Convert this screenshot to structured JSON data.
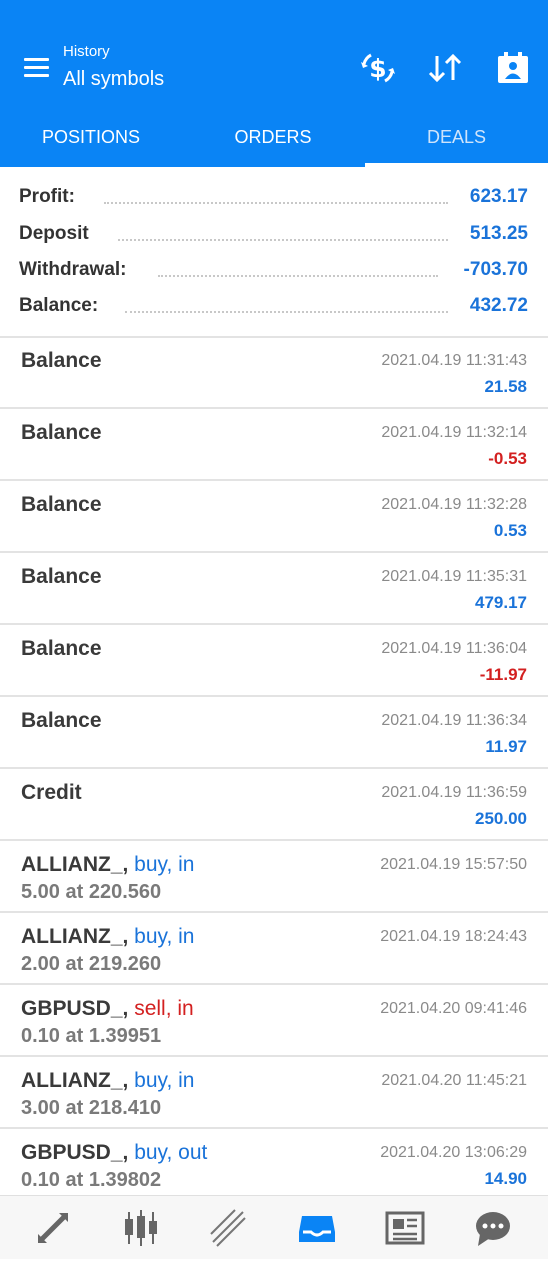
{
  "header": {
    "subtitle": "History",
    "title": "All symbols"
  },
  "tabs": [
    {
      "label": "POSITIONS"
    },
    {
      "label": "ORDERS"
    },
    {
      "label": "DEALS"
    }
  ],
  "active_tab": "DEALS",
  "summary": {
    "profit": {
      "label": "Profit:",
      "value": "623.17"
    },
    "deposit": {
      "label": "Deposit",
      "value": "513.25"
    },
    "withdrawal": {
      "label": "Withdrawal:",
      "value": "-703.70"
    },
    "balance": {
      "label": "Balance:",
      "value": "432.72"
    }
  },
  "deals": [
    {
      "name": "Balance",
      "time": "2021.04.19 11:31:43",
      "amount": "21.58",
      "amount_color": "blue"
    },
    {
      "name": "Balance",
      "time": "2021.04.19 11:32:14",
      "amount": "-0.53",
      "amount_color": "red"
    },
    {
      "name": "Balance",
      "time": "2021.04.19 11:32:28",
      "amount": "0.53",
      "amount_color": "blue"
    },
    {
      "name": "Balance",
      "time": "2021.04.19 11:35:31",
      "amount": "479.17",
      "amount_color": "blue"
    },
    {
      "name": "Balance",
      "time": "2021.04.19 11:36:04",
      "amount": "-11.97",
      "amount_color": "red"
    },
    {
      "name": "Balance",
      "time": "2021.04.19 11:36:34",
      "amount": "11.97",
      "amount_color": "blue"
    },
    {
      "name": "Credit",
      "time": "2021.04.19 11:36:59",
      "amount": "250.00",
      "amount_color": "blue"
    },
    {
      "name": "ALLIANZ_,",
      "type": "buy, in",
      "type_color": "blue",
      "detail": "5.00 at 220.560",
      "time": "2021.04.19 15:57:50"
    },
    {
      "name": "ALLIANZ_,",
      "type": "buy, in",
      "type_color": "blue",
      "detail": "2.00 at 219.260",
      "time": "2021.04.19 18:24:43"
    },
    {
      "name": "GBPUSD_,",
      "type": "sell, in",
      "type_color": "red",
      "detail": "0.10 at 1.39951",
      "time": "2021.04.20 09:41:46"
    },
    {
      "name": "ALLIANZ_,",
      "type": "buy, in",
      "type_color": "blue",
      "detail": "3.00 at 218.410",
      "time": "2021.04.20 11:45:21"
    },
    {
      "name": "GBPUSD_,",
      "type": "buy, out",
      "type_color": "blue",
      "detail": "0.10 at 1.39802",
      "time": "2021.04.20 13:06:29",
      "amount": "14.90",
      "amount_color": "blue"
    }
  ],
  "bottom_nav": [
    {
      "icon": "quotes-arrows-icon"
    },
    {
      "icon": "chart-candles-icon"
    },
    {
      "icon": "trade-lines-icon"
    },
    {
      "icon": "history-inbox-icon",
      "active": true
    },
    {
      "icon": "news-icon"
    },
    {
      "icon": "chat-icon"
    }
  ],
  "colors": {
    "accent": "#0a84f5",
    "positive": "#1a73d9",
    "negative": "#d32020"
  }
}
